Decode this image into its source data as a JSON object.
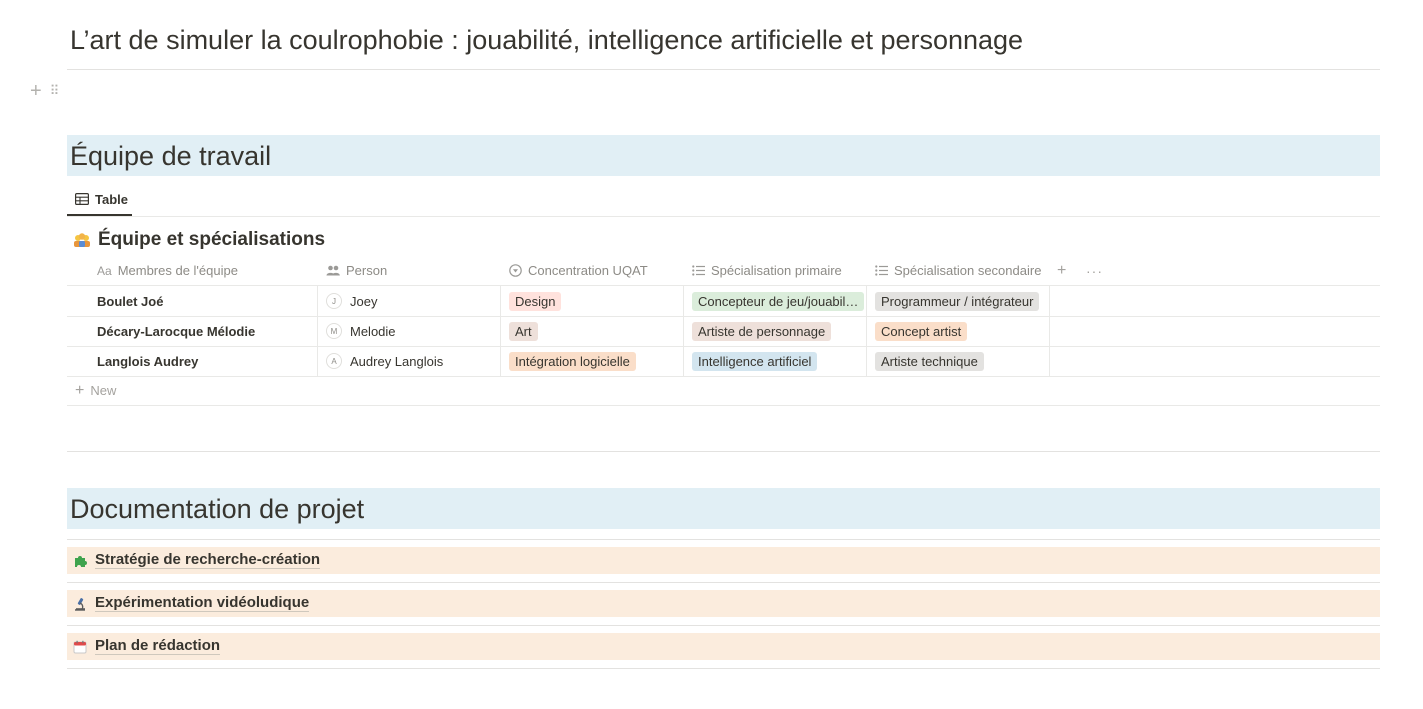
{
  "page": {
    "title": "L’art de simuler la coulrophobie : jouabilité, intelligence artificielle et personnage"
  },
  "team_section": {
    "heading": "Équipe de travail",
    "tab": {
      "label": "Table",
      "icon": "table-icon"
    },
    "database": {
      "title": "Équipe et spécialisations",
      "icon": "people-emoji-icon",
      "columns": [
        {
          "label": "Membres de l'équipe",
          "icon": "title-aa-icon"
        },
        {
          "label": "Person",
          "icon": "people-icon"
        },
        {
          "label": "Concentration UQAT",
          "icon": "select-icon"
        },
        {
          "label": "Spécialisation primaire",
          "icon": "list-icon"
        },
        {
          "label": "Spécialisation secondaire",
          "icon": "list-icon"
        }
      ],
      "rows": [
        {
          "member": "Boulet Joé",
          "person": {
            "initial": "J",
            "name": "Joey"
          },
          "concentration": {
            "label": "Design",
            "color": "#ffe2dd"
          },
          "primary": {
            "label": "Concepteur de jeu/jouabil…",
            "color": "#dbeddb"
          },
          "secondary": {
            "label": "Programmeur / intégrateur",
            "color": "#e3e2e0"
          }
        },
        {
          "member": "Décary-Larocque Mélodie",
          "person": {
            "initial": "M",
            "name": "Melodie"
          },
          "concentration": {
            "label": "Art",
            "color": "#eee0da"
          },
          "primary": {
            "label": "Artiste de personnage",
            "color": "#eee0da"
          },
          "secondary": {
            "label": "Concept artist",
            "color": "#fadec9"
          }
        },
        {
          "member": "Langlois Audrey",
          "person": {
            "initial": "A",
            "name": "Audrey Langlois"
          },
          "concentration": {
            "label": "Intégration logicielle",
            "color": "#fadec9"
          },
          "primary": {
            "label": "Intelligence artificiel",
            "color": "#d3e5ef"
          },
          "secondary": {
            "label": "Artiste technique",
            "color": "#e3e2e0"
          }
        }
      ],
      "new_label": "New"
    }
  },
  "docs_section": {
    "heading": "Documentation de projet",
    "items": [
      {
        "label": "Stratégie de recherche-création",
        "icon": "puzzle-icon"
      },
      {
        "label": "Expérimentation vidéoludique",
        "icon": "microscope-icon"
      },
      {
        "label": "Plan de rédaction",
        "icon": "calendar-icon"
      }
    ]
  },
  "colors": {
    "heading_bg": "#e1eff5",
    "doc_item_bg": "#fbecdd"
  }
}
